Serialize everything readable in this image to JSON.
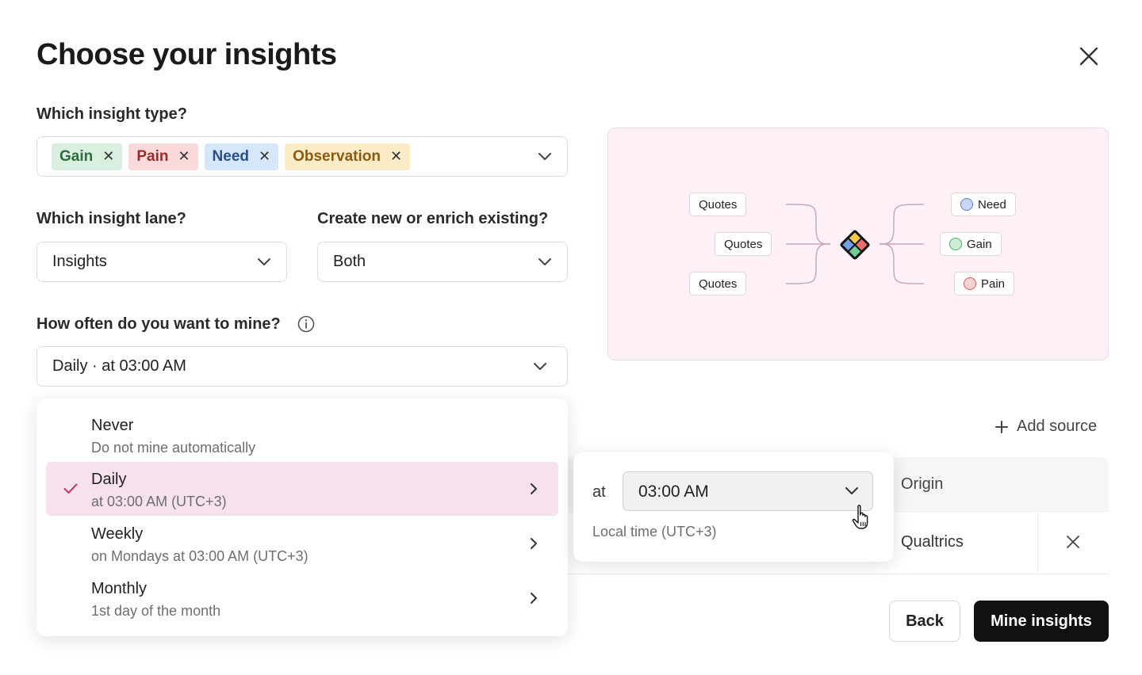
{
  "dialog": {
    "title": "Choose your insights"
  },
  "insight_type": {
    "label": "Which insight type?",
    "chips": [
      {
        "label": "Gain",
        "color": "#d9efdf"
      },
      {
        "label": "Pain",
        "color": "#f9d9d9"
      },
      {
        "label": "Need",
        "color": "#d6e6fb"
      },
      {
        "label": "Observation",
        "color": "#fbecc7"
      }
    ]
  },
  "insight_lane": {
    "label": "Which insight lane?",
    "value": "Insights"
  },
  "create_or_enrich": {
    "label": "Create new or enrich existing?",
    "value": "Both"
  },
  "frequency": {
    "label": "How often do you want to mine?",
    "value": "Daily · at 03:00 AM",
    "options": [
      {
        "title": "Never",
        "subtitle": "Do not mine automatically",
        "selected": false
      },
      {
        "title": "Daily",
        "subtitle": "at 03:00 AM (UTC+3)",
        "selected": true
      },
      {
        "title": "Weekly",
        "subtitle": "on Mondays at 03:00 AM (UTC+3)",
        "selected": false
      },
      {
        "title": "Monthly",
        "subtitle": "1st day of the month",
        "selected": false
      }
    ]
  },
  "time_popover": {
    "at_label": "at",
    "time_value": "03:00 AM",
    "note": "Local time (UTC+3)"
  },
  "preview": {
    "quotes": [
      "Quotes",
      "Quotes",
      "Quotes"
    ],
    "outputs": [
      {
        "label": "Need",
        "color": "#5b7fd6"
      },
      {
        "label": "Gain",
        "color": "#4fae6c"
      },
      {
        "label": "Pain",
        "color": "#e05a5a"
      }
    ],
    "accent": "#fdf0f6"
  },
  "sources": {
    "add_label": "Add source",
    "column_origin": "Origin",
    "rows": [
      {
        "origin": "Qualtrics"
      }
    ]
  },
  "footer": {
    "back_label": "Back",
    "primary_label": "Mine insights",
    "primary_color": "#111111"
  }
}
